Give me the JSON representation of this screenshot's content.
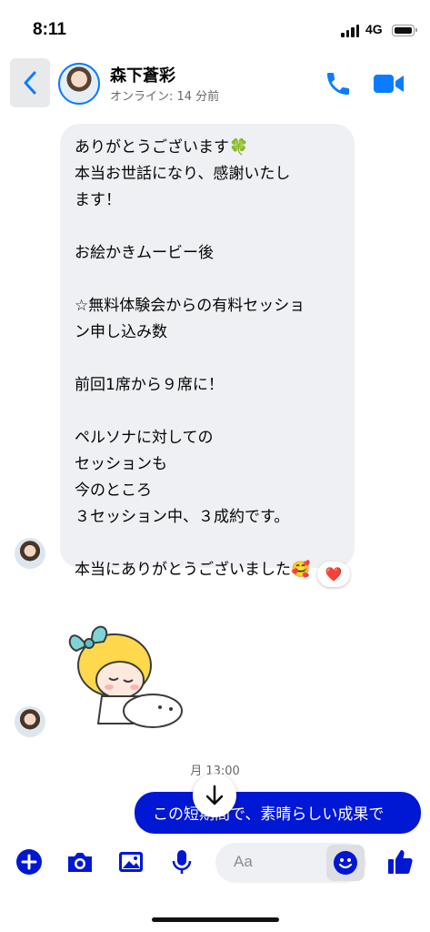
{
  "status_bar": {
    "time": "8:11",
    "network": "4G"
  },
  "header": {
    "contact_name": "森下蒼彩",
    "status": "オンライン: 14 分前"
  },
  "incoming_message": {
    "lines": [
      "ありがとうございます🍀",
      "本当お世話になり、感謝いたし",
      "ます！",
      "",
      "お絵かきムービー後",
      "",
      "☆無料体験会からの有料セッショ",
      "ン申し込み数",
      "",
      "前回1席から９席に！",
      "",
      "ペルソナに対しての",
      "セッションも",
      "今のところ",
      "３セッション中、３成約です。",
      "",
      "本当にありがとうございました🥰"
    ],
    "reaction": "❤️"
  },
  "timestamp": "月 13:00",
  "outgoing_message": {
    "text": "この短期間で、素晴らしい成果で"
  },
  "composer": {
    "placeholder": "Aa"
  },
  "colors": {
    "accent": "#0a7cff",
    "outgoing_bubble": "#0017d4",
    "composer_icons": "#0017d4",
    "incoming_bubble": "#eff0f3"
  }
}
